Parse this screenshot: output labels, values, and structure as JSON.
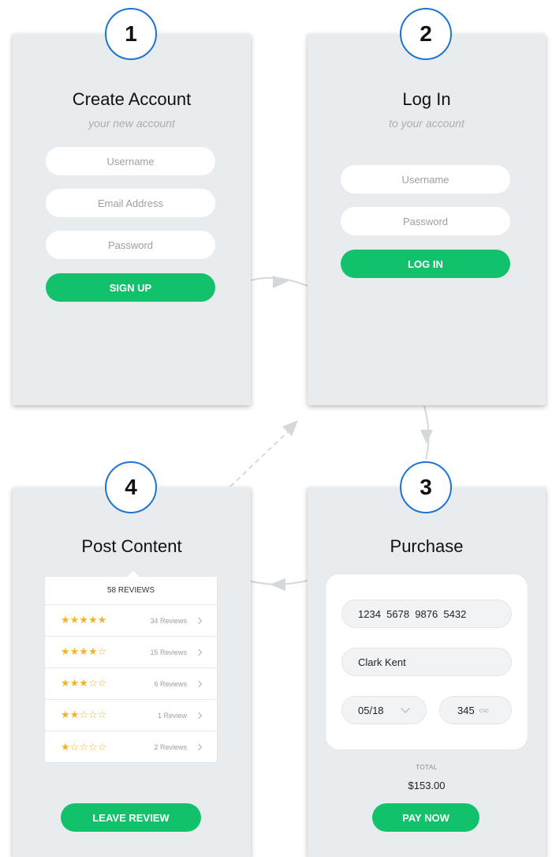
{
  "steps": {
    "create": {
      "number": "1",
      "title": "Create Account",
      "subtitle": "your new account",
      "username_placeholder": "Username",
      "email_placeholder": "Email Address",
      "password_placeholder": "Password",
      "button_label": "SIGN UP"
    },
    "login": {
      "number": "2",
      "title": "Log In",
      "subtitle": "to your account",
      "username_placeholder": "Username",
      "password_placeholder": "Password",
      "button_label": "LOG IN"
    },
    "purchase": {
      "number": "3",
      "title": "Purchase",
      "card_number": "1234  5678  9876  5432",
      "card_name": "Clark Kent",
      "expiry": "05/18",
      "cvc_value": "345",
      "cvc_label": "cvc",
      "total_label": "TOTAL",
      "total_value": "$153.00",
      "button_label": "PAY NOW"
    },
    "post": {
      "number": "4",
      "title": "Post Content",
      "reviews_header": "58 REVIEWS",
      "rows": [
        {
          "stars": "★★★★★",
          "rating": 5,
          "count": "34 Reviews"
        },
        {
          "stars": "★★★★☆",
          "rating": 4,
          "count": "15 Reviews"
        },
        {
          "stars": "★★★☆☆",
          "rating": 3,
          "count": "6 Reviews"
        },
        {
          "stars": "★★☆☆☆",
          "rating": 2,
          "count": "1 Review"
        },
        {
          "stars": "★☆☆☆☆",
          "rating": 1,
          "count": "2 Reviews"
        }
      ],
      "button_label": "LEAVE REVIEW"
    }
  },
  "colors": {
    "card_bg": "#e9ecef",
    "badge_border": "#1d74d2",
    "button_green": "#11c26b",
    "star_gold": "#f2b22a",
    "arrow_gray": "#d3d8dd"
  }
}
